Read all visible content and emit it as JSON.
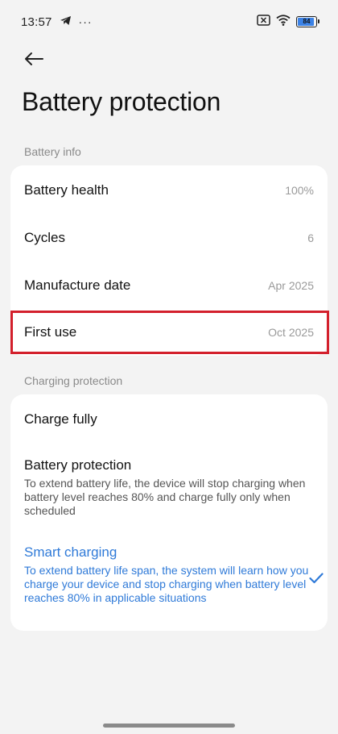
{
  "status_bar": {
    "time": "13:57",
    "more": "···",
    "battery_level": "84",
    "battery_fraction": 0.84,
    "icons": [
      "telegram-icon",
      "overflow-dots-icon",
      "sim-none-icon",
      "wifi-icon",
      "battery-icon"
    ]
  },
  "header": {
    "title": "Battery protection",
    "back_icon": "arrow-left-icon"
  },
  "battery_info": {
    "section_label": "Battery info",
    "rows": [
      {
        "label": "Battery health",
        "value": "100%"
      },
      {
        "label": "Cycles",
        "value": "6"
      },
      {
        "label": "Manufacture date",
        "value": "Apr 2025"
      },
      {
        "label": "First use",
        "value": "Oct 2025"
      }
    ]
  },
  "charging_protection": {
    "section_label": "Charging protection",
    "options": [
      {
        "title": "Charge fully",
        "description": "",
        "selected": false
      },
      {
        "title": "Battery protection",
        "description": "To extend battery life, the device will stop charging when battery level reaches 80% and charge fully only when scheduled",
        "selected": false
      },
      {
        "title": "Smart charging",
        "description": "To extend battery life span, the system will learn how you charge your device and stop charging when battery level reaches 80% in applicable situations",
        "selected": true
      }
    ]
  },
  "colors": {
    "accent": "#2f7ad8",
    "highlight": "#d3202c",
    "background": "#f3f3f3",
    "card": "#ffffff"
  }
}
